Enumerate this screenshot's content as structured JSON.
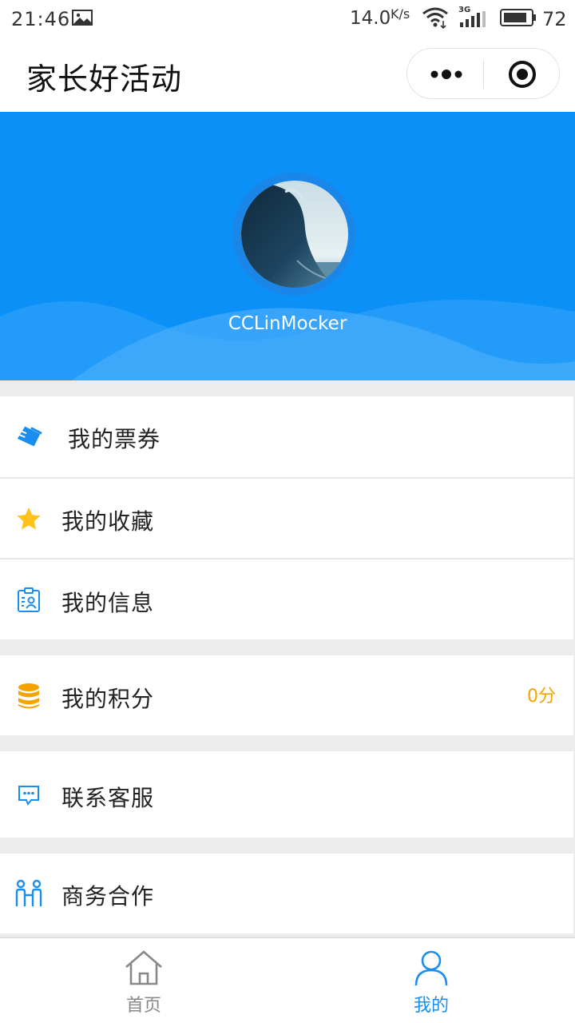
{
  "status_bar": {
    "time": "21:46",
    "net_speed": "14.0",
    "net_unit": "K/s",
    "network_type": "3G",
    "battery": "72",
    "icons": [
      "gallery-icon",
      "wifi-icon",
      "signal-icon",
      "battery-icon"
    ]
  },
  "navbar": {
    "title": "家长好活动",
    "more_icon": "more-dots-icon",
    "close_icon": "close-circle-icon"
  },
  "profile": {
    "username": "CCLinMocker",
    "header_color": "#0b90f8"
  },
  "menu": {
    "items": [
      {
        "label": "我的票券",
        "icon": "ticket-icon"
      },
      {
        "label": "我的收藏",
        "icon": "star-icon"
      },
      {
        "label": "我的信息",
        "icon": "id-badge-icon"
      },
      {
        "label": "我的积分",
        "icon": "coins-icon",
        "value": "0分"
      },
      {
        "label": "联系客服",
        "icon": "chat-bubble-icon"
      },
      {
        "label": "商务合作",
        "icon": "partners-icon"
      }
    ]
  },
  "tabbar": {
    "tabs": [
      {
        "label": "首页",
        "icon": "home-icon",
        "active": false
      },
      {
        "label": "我的",
        "icon": "user-icon",
        "active": true
      }
    ],
    "active_color": "#1a8ef0",
    "inactive_color": "#888888"
  },
  "colors": {
    "accent": "#1a8ef0",
    "points": "#f5a300",
    "star": "#ffc21a"
  }
}
